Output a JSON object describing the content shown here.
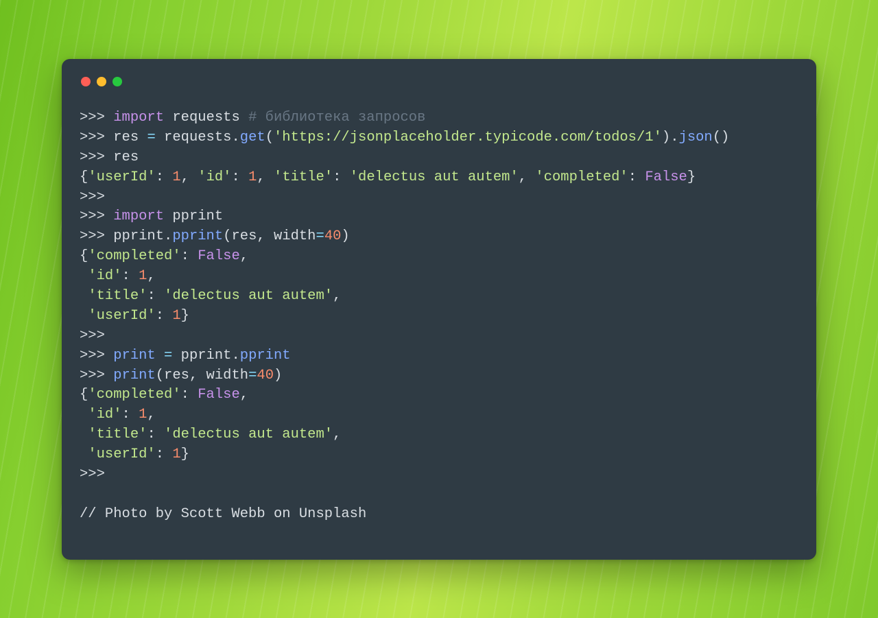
{
  "window": {
    "traffic": [
      "red",
      "yellow",
      "green"
    ]
  },
  "colors": {
    "card": "#2f3b44",
    "red": "#ff5f56",
    "yellow": "#ffbd2e",
    "green": "#27c93f",
    "keyword": "#c792ea",
    "builtin": "#82aaff",
    "string": "#c3e88d",
    "number": "#f78c6c",
    "comment": "#697785",
    "operator": "#89ddff",
    "text": "#d9dee3"
  },
  "code": {
    "prompt": ">>>",
    "lines": [
      [
        {
          "t": ">>> ",
          "c": "prompt"
        },
        {
          "t": "import ",
          "c": "kw"
        },
        {
          "t": "requests ",
          "c": "default"
        },
        {
          "t": "# библиотека запросов",
          "c": "comment"
        }
      ],
      [
        {
          "t": ">>> ",
          "c": "prompt"
        },
        {
          "t": "res ",
          "c": "default"
        },
        {
          "t": "= ",
          "c": "op"
        },
        {
          "t": "requests",
          "c": "default"
        },
        {
          "t": ".",
          "c": "default"
        },
        {
          "t": "get",
          "c": "func"
        },
        {
          "t": "(",
          "c": "paren"
        },
        {
          "t": "'https://jsonplaceholder.typicode.com/todos/1'",
          "c": "string"
        },
        {
          "t": ")",
          "c": "paren"
        },
        {
          "t": ".",
          "c": "default"
        },
        {
          "t": "json",
          "c": "func"
        },
        {
          "t": "()",
          "c": "paren"
        }
      ],
      [
        {
          "t": ">>> ",
          "c": "prompt"
        },
        {
          "t": "res",
          "c": "default"
        }
      ],
      [
        {
          "t": "{",
          "c": "default"
        },
        {
          "t": "'userId'",
          "c": "string"
        },
        {
          "t": ": ",
          "c": "default"
        },
        {
          "t": "1",
          "c": "num"
        },
        {
          "t": ", ",
          "c": "default"
        },
        {
          "t": "'id'",
          "c": "string"
        },
        {
          "t": ": ",
          "c": "default"
        },
        {
          "t": "1",
          "c": "num"
        },
        {
          "t": ", ",
          "c": "default"
        },
        {
          "t": "'title'",
          "c": "string"
        },
        {
          "t": ": ",
          "c": "default"
        },
        {
          "t": "'delectus aut autem'",
          "c": "string"
        },
        {
          "t": ", ",
          "c": "default"
        },
        {
          "t": "'completed'",
          "c": "string"
        },
        {
          "t": ": ",
          "c": "default"
        },
        {
          "t": "False",
          "c": "bool"
        },
        {
          "t": "}",
          "c": "default"
        }
      ],
      [
        {
          "t": ">>>",
          "c": "prompt"
        }
      ],
      [
        {
          "t": ">>> ",
          "c": "prompt"
        },
        {
          "t": "import ",
          "c": "kw"
        },
        {
          "t": "pprint",
          "c": "default"
        }
      ],
      [
        {
          "t": ">>> ",
          "c": "prompt"
        },
        {
          "t": "pprint",
          "c": "default"
        },
        {
          "t": ".",
          "c": "default"
        },
        {
          "t": "pprint",
          "c": "func"
        },
        {
          "t": "(",
          "c": "paren"
        },
        {
          "t": "res, width",
          "c": "default"
        },
        {
          "t": "=",
          "c": "op"
        },
        {
          "t": "40",
          "c": "num"
        },
        {
          "t": ")",
          "c": "paren"
        }
      ],
      [
        {
          "t": "{",
          "c": "default"
        },
        {
          "t": "'completed'",
          "c": "string"
        },
        {
          "t": ": ",
          "c": "default"
        },
        {
          "t": "False",
          "c": "bool"
        },
        {
          "t": ",",
          "c": "default"
        }
      ],
      [
        {
          "t": " ",
          "c": "default"
        },
        {
          "t": "'id'",
          "c": "string"
        },
        {
          "t": ": ",
          "c": "default"
        },
        {
          "t": "1",
          "c": "num"
        },
        {
          "t": ",",
          "c": "default"
        }
      ],
      [
        {
          "t": " ",
          "c": "default"
        },
        {
          "t": "'title'",
          "c": "string"
        },
        {
          "t": ": ",
          "c": "default"
        },
        {
          "t": "'delectus aut autem'",
          "c": "string"
        },
        {
          "t": ",",
          "c": "default"
        }
      ],
      [
        {
          "t": " ",
          "c": "default"
        },
        {
          "t": "'userId'",
          "c": "string"
        },
        {
          "t": ": ",
          "c": "default"
        },
        {
          "t": "1",
          "c": "num"
        },
        {
          "t": "}",
          "c": "default"
        }
      ],
      [
        {
          "t": ">>>",
          "c": "prompt"
        }
      ],
      [
        {
          "t": ">>> ",
          "c": "prompt"
        },
        {
          "t": "print",
          "c": "builtin"
        },
        {
          "t": " ",
          "c": "default"
        },
        {
          "t": "= ",
          "c": "op"
        },
        {
          "t": "pprint",
          "c": "default"
        },
        {
          "t": ".",
          "c": "default"
        },
        {
          "t": "pprint",
          "c": "func"
        }
      ],
      [
        {
          "t": ">>> ",
          "c": "prompt"
        },
        {
          "t": "print",
          "c": "builtin"
        },
        {
          "t": "(",
          "c": "paren"
        },
        {
          "t": "res, width",
          "c": "default"
        },
        {
          "t": "=",
          "c": "op"
        },
        {
          "t": "40",
          "c": "num"
        },
        {
          "t": ")",
          "c": "paren"
        }
      ],
      [
        {
          "t": "{",
          "c": "default"
        },
        {
          "t": "'completed'",
          "c": "string"
        },
        {
          "t": ": ",
          "c": "default"
        },
        {
          "t": "False",
          "c": "bool"
        },
        {
          "t": ",",
          "c": "default"
        }
      ],
      [
        {
          "t": " ",
          "c": "default"
        },
        {
          "t": "'id'",
          "c": "string"
        },
        {
          "t": ": ",
          "c": "default"
        },
        {
          "t": "1",
          "c": "num"
        },
        {
          "t": ",",
          "c": "default"
        }
      ],
      [
        {
          "t": " ",
          "c": "default"
        },
        {
          "t": "'title'",
          "c": "string"
        },
        {
          "t": ": ",
          "c": "default"
        },
        {
          "t": "'delectus aut autem'",
          "c": "string"
        },
        {
          "t": ",",
          "c": "default"
        }
      ],
      [
        {
          "t": " ",
          "c": "default"
        },
        {
          "t": "'userId'",
          "c": "string"
        },
        {
          "t": ": ",
          "c": "default"
        },
        {
          "t": "1",
          "c": "num"
        },
        {
          "t": "}",
          "c": "default"
        }
      ],
      [
        {
          "t": ">>>",
          "c": "prompt"
        }
      ],
      [
        {
          "t": "",
          "c": "default"
        }
      ],
      [
        {
          "t": "// Photo by Scott Webb on Unsplash",
          "c": "default"
        }
      ]
    ]
  }
}
